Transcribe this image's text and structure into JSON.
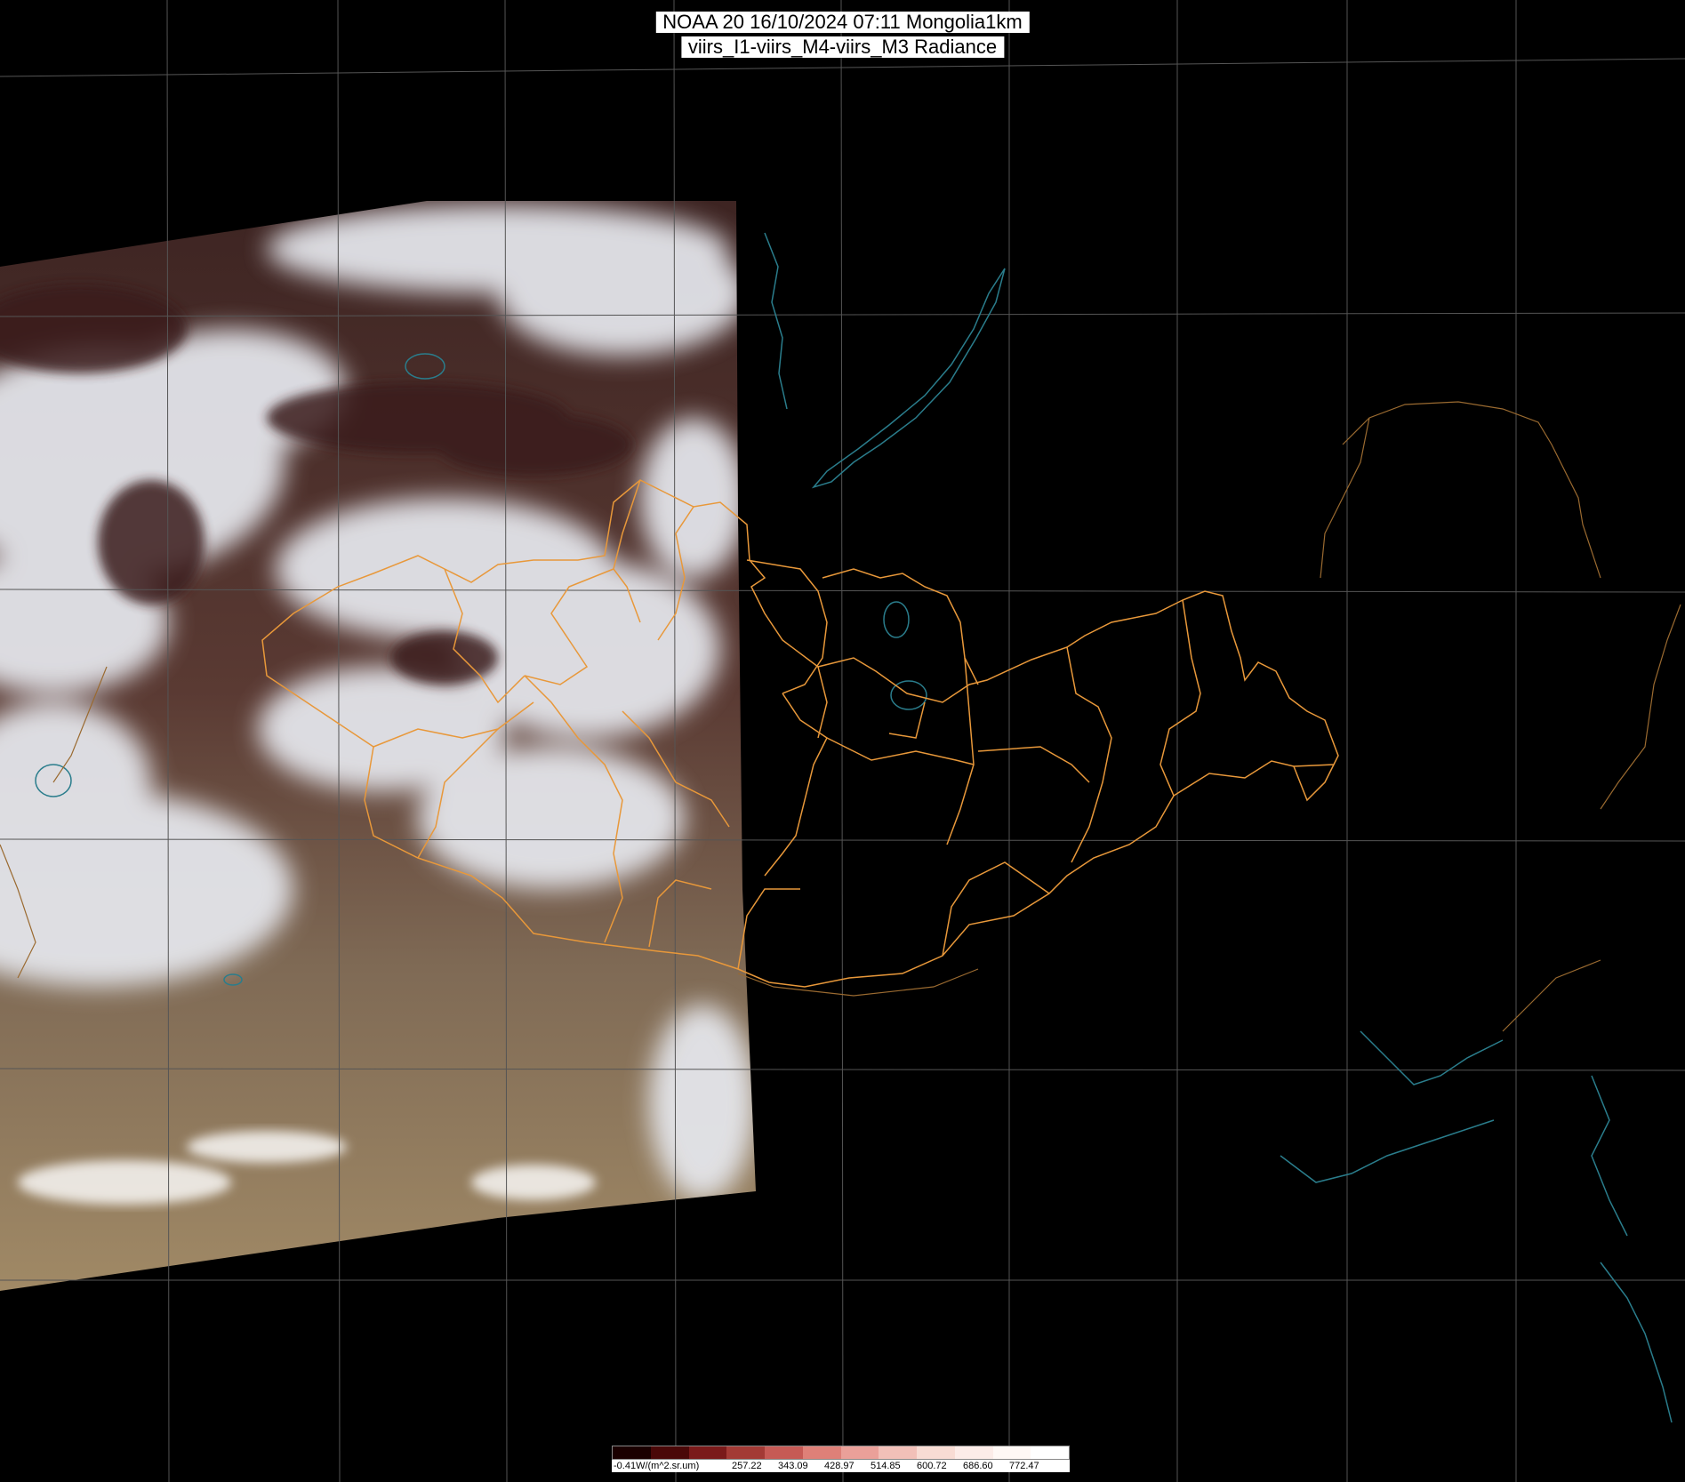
{
  "header": {
    "line1": "NOAA 20 16/10/2024 07:11 Mongolia1km",
    "line2": "viirs_I1-viirs_M4-viirs_M3 Radiance"
  },
  "colorbar": {
    "unit_label": "-0.41W/(m^2.sr.um)",
    "ticks": [
      "257.22",
      "343.09",
      "428.97",
      "514.85",
      "600.72",
      "686.60",
      "772.47"
    ],
    "colors": [
      "#1a0000",
      "#4a0808",
      "#7a1a1a",
      "#a33a35",
      "#c65a55",
      "#de8078",
      "#eaa099",
      "#f2c0b8",
      "#f8dcd4",
      "#fcece8",
      "#fff8f5",
      "#ffffff"
    ]
  },
  "map": {
    "grid_color": "#555555",
    "border_color": "#e8983a",
    "coast_color": "#2a7d8c",
    "cloud_color": "#e6e8ee",
    "land_color": "#4a2a28",
    "desert_color": "#9a8668"
  }
}
